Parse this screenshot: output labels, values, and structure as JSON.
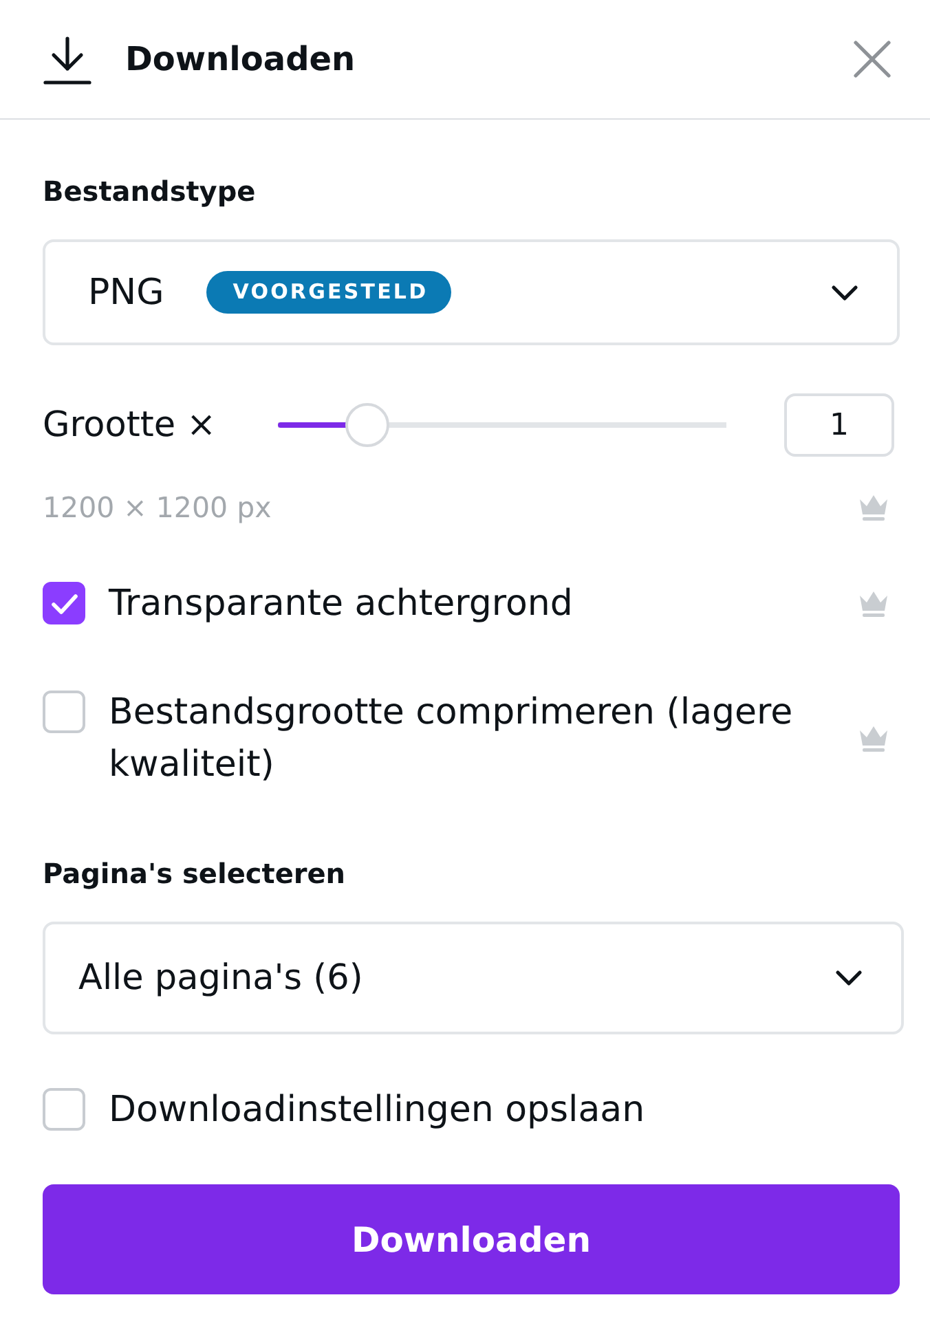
{
  "header": {
    "title": "Downloaden"
  },
  "file_type": {
    "label": "Bestandstype",
    "value": "PNG",
    "badge": "VOORGESTELD"
  },
  "size": {
    "label": "Grootte ×",
    "level": 0.2,
    "value": "1",
    "dimensions": "1200 × 1200 px",
    "premium": true
  },
  "options": [
    {
      "label": "Transparante achtergrond",
      "checked": true,
      "premium": true
    },
    {
      "label": "Bestandsgrootte comprimeren (lagere kwaliteit)",
      "checked": false,
      "premium": true
    }
  ],
  "pages": {
    "label": "Pagina's selecteren",
    "value": "Alle pagina's (6)"
  },
  "save_settings": {
    "label": "Downloadinstellingen opslaan",
    "checked": false,
    "premium": false
  },
  "button": {
    "label": "Downloaden"
  }
}
